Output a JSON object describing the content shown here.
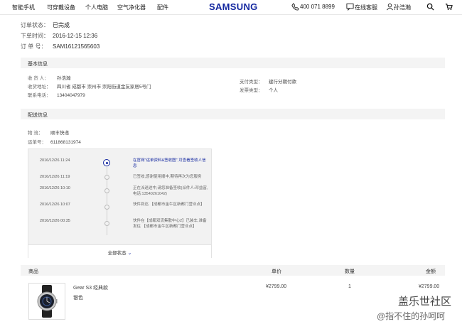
{
  "nav": {
    "items": [
      "智能手机",
      "可穿戴设备",
      "个人电脑",
      "空气净化器",
      "配件"
    ],
    "logo": "SAMSUNG",
    "phone": "400 071 8899",
    "service": "在线客服",
    "user": "孙浩瀚"
  },
  "order": {
    "status_label": "订单状态：",
    "status": "已完成",
    "time_label": "下单时间：",
    "time": "2016-12-15 12:36",
    "number_label": "订 单 号：",
    "number": "SAM16121565603"
  },
  "basic": {
    "title": "基本信息",
    "receiver_label": "收 货 人：",
    "receiver": "孙浩瀚",
    "address_label": "收货地址：",
    "address": "四川省  成都市  崇州市  崇阳街道金友家居5号门",
    "phone_label": "联系电话：",
    "phone": "13404047979",
    "pay_label": "支付类型：",
    "pay": "建行分期付款",
    "invoice_label": "发票类型：",
    "invoice": "个人"
  },
  "delivery": {
    "title": "配送信息",
    "courier_label": "物    流：",
    "courier": "顺丰快递",
    "waybill_label": "运单号：",
    "waybill": "611868131974",
    "timeline": [
      {
        "date": "2016/12/26 11:24",
        "desc": "在官网\"运单资料&签收图\",可查看签收人信息"
      },
      {
        "date": "2016/12/26 11:19",
        "desc": "已签收,感谢使用顺丰,期待再次为您服务"
      },
      {
        "date": "2016/12/26 10:10",
        "desc": "正在派送途中,请您准备签收(派件人:邓益富,电话:13540261042)"
      },
      {
        "date": "2016/12/26 10:07",
        "desc": "快件到达 【成都市金牛区新都门营业点】"
      },
      {
        "date": "2016/12/26 00:35",
        "desc": "快件在【成都双流集散中心2】已装车,准备发往 【成都市金牛区新都门营业点】"
      }
    ],
    "more": "全部状态"
  },
  "goods": {
    "col_product": "商品",
    "col_price": "单价",
    "col_qty": "数量",
    "col_amount": "金额",
    "name": "Gear S3 经典款",
    "color": "银色",
    "price": "¥2799.00",
    "qty": "1",
    "amount": "¥2799.00"
  },
  "watermark": {
    "line1": "盖乐世社区",
    "line2": "@指不住的孙呵呵"
  },
  "colors": {
    "brand": "#1428a0"
  },
  "icons": [
    "phone-icon",
    "chat-icon",
    "user-icon",
    "search-icon",
    "cart-icon",
    "chevron-down-icon"
  ]
}
